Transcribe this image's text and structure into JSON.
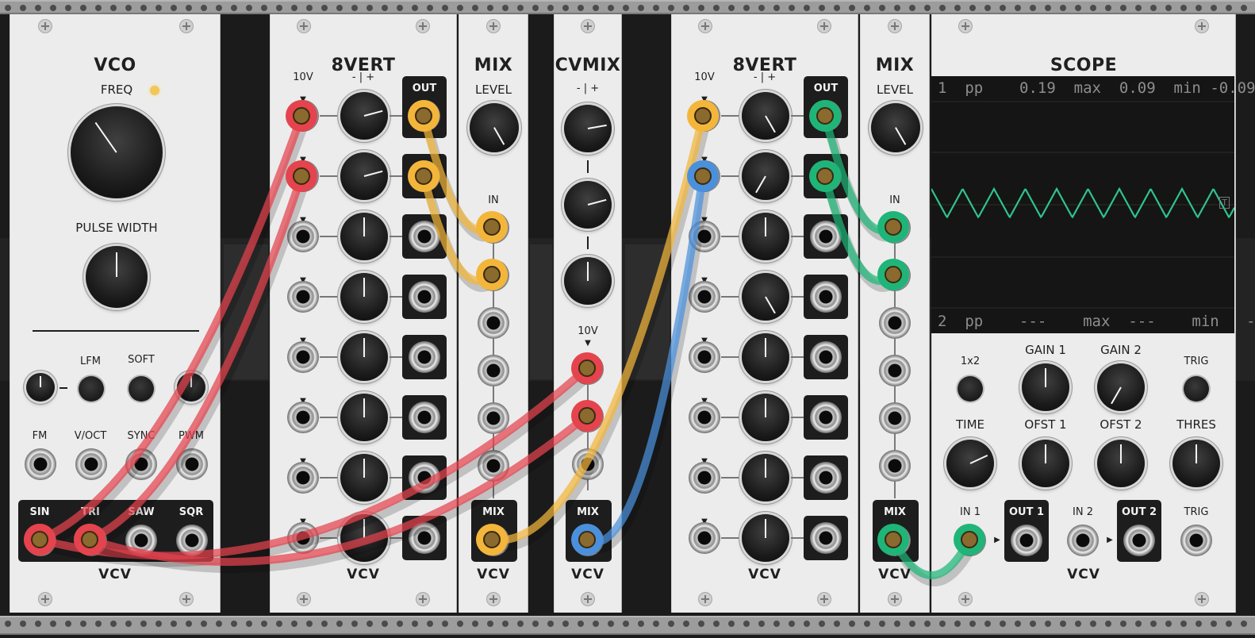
{
  "modules": {
    "vco": {
      "title": "VCO",
      "freq_label": "FREQ",
      "pulse_label": "PULSE WIDTH",
      "lfm_label": "LFM",
      "soft_label": "SOFT",
      "fm_label": "FM",
      "voct_label": "V/OCT",
      "sync_label": "SYNC",
      "pwm_label": "PWM",
      "sin_label": "SIN",
      "tri_label": "TRI",
      "saw_label": "SAW",
      "sqr_label": "SQR",
      "brand": "VCV"
    },
    "eightvert_1": {
      "title": "8VERT",
      "range_label": "10V",
      "polarity_label": "- | +",
      "out_label": "OUT",
      "brand": "VCV"
    },
    "mix_1": {
      "title": "MIX",
      "level_label": "LEVEL",
      "in_label": "IN",
      "mix_label": "MIX",
      "brand": "VCV"
    },
    "cvmix": {
      "title": "CVMIX",
      "polarity_label": "- | +",
      "range_label": "10V",
      "mix_label": "MIX",
      "brand": "VCV"
    },
    "eightvert_2": {
      "title": "8VERT",
      "range_label": "10V",
      "polarity_label": "- | +",
      "out_label": "OUT",
      "brand": "VCV"
    },
    "mix_2": {
      "title": "MIX",
      "level_label": "LEVEL",
      "in_label": "IN",
      "mix_label": "MIX",
      "brand": "VCV"
    },
    "scope": {
      "title": "SCOPE",
      "ch1": {
        "num": "1",
        "pp_label": "pp",
        "pp": "0.19",
        "max_label": "max",
        "max": "0.09",
        "min_label": "min",
        "min": "-0.09"
      },
      "ch2": {
        "num": "2",
        "pp_label": "pp",
        "pp": "---",
        "max_label": "max",
        "max": "---",
        "min_label": "min",
        "min": "---"
      },
      "trigger_marker": "T",
      "x2_label": "1x2",
      "gain1_label": "GAIN 1",
      "gain2_label": "GAIN 2",
      "trig_btn_label": "TRIG",
      "time_label": "TIME",
      "ofst1_label": "OFST 1",
      "ofst2_label": "OFST 2",
      "thres_label": "THRES",
      "in1_label": "IN 1",
      "out1_label": "OUT 1",
      "in2_label": "IN 2",
      "out2_label": "OUT 2",
      "trig_in_label": "TRIG",
      "brand": "VCV",
      "trace_color": "#2fc48c"
    }
  },
  "colors": {
    "red": "#e5434d",
    "orange": "#f3b63a",
    "green": "#1fb578",
    "blue": "#4a90dc"
  }
}
